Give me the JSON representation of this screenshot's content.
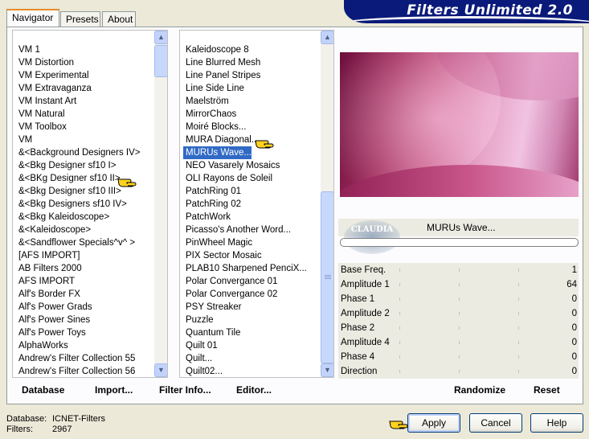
{
  "window": {
    "title": "Filters Unlimited 2.0"
  },
  "tabs": [
    {
      "label": "Navigator",
      "active": true
    },
    {
      "label": "Presets",
      "active": false
    },
    {
      "label": "About",
      "active": false
    }
  ],
  "categories": {
    "items": [
      "VM 1",
      "VM Distortion",
      "VM Experimental",
      "VM Extravaganza",
      "VM Instant Art",
      "VM Natural",
      "VM Toolbox",
      "VM",
      "&<Background Designers IV>",
      "&<Bkg Designer sf10 I>",
      "&<BKg Designer sf10 II>",
      "&<Bkg Designer sf10 III>",
      "&<Bkg Designers sf10 IV>",
      "&<Bkg Kaleidoscope>",
      "&<Kaleidoscope>",
      "&<Sandflower Specials^v^ >",
      "[AFS IMPORT]",
      "AB Filters 2000",
      "AFS IMPORT",
      "Alf's Border FX",
      "Alf's Power Grads",
      "Alf's Power Sines",
      "Alf's Power Toys",
      "AlphaWorks",
      "Andrew's Filter Collection 55",
      "Andrew's Filter Collection 56"
    ],
    "highlighted_index": 10
  },
  "filters": {
    "items": [
      "Kaleidoscope 8",
      "Line Blurred Mesh",
      "Line Panel Stripes",
      "Line Side Line",
      "Maelström",
      "MirrorChaos",
      "Moiré Blocks...",
      "MURA Diagonal...",
      "MURUs Wave...",
      "NEO Vasarely Mosaics",
      "OLI Rayons de Soleil",
      "PatchRing 01",
      "PatchRing 02",
      "PatchWork",
      "Picasso's Another Word...",
      "PinWheel Magic",
      "PIX Sector Mosaic",
      "PLAB10 Sharpened PenciX...",
      "Polar Convergance 01",
      "Polar Convergance 02",
      "PSY Streaker",
      "Puzzle",
      "Quantum Tile",
      "Quilt 01",
      "Quilt...",
      "Quilt02..."
    ],
    "selected_index": 8
  },
  "filter_panel": {
    "name": "MURUs Wave...",
    "watermark": "CLAUDIA",
    "params": [
      {
        "label": "Base Freq.",
        "value": "1"
      },
      {
        "label": "Amplitude 1",
        "value": "64"
      },
      {
        "label": "Phase 1",
        "value": "0"
      },
      {
        "label": "Amplitude 2",
        "value": "0"
      },
      {
        "label": "Phase 2",
        "value": "0"
      },
      {
        "label": "Amplitude 4",
        "value": "0"
      },
      {
        "label": "Phase 4",
        "value": "0"
      },
      {
        "label": "Direction",
        "value": "0"
      }
    ]
  },
  "toolbar": {
    "database": "Database",
    "import": "Import...",
    "filter_info": "Filter Info...",
    "editor": "Editor...",
    "randomize": "Randomize",
    "reset": "Reset"
  },
  "status": {
    "database_label": "Database:",
    "database_value": "ICNET-Filters",
    "filters_label": "Filters:",
    "filters_value": "2967"
  },
  "buttons": {
    "apply": "Apply",
    "cancel": "Cancel",
    "help": "Help"
  },
  "colors": {
    "selection": "#316ac5",
    "banner": "#0a1a7a",
    "tab_accent": "#e68b2c"
  }
}
